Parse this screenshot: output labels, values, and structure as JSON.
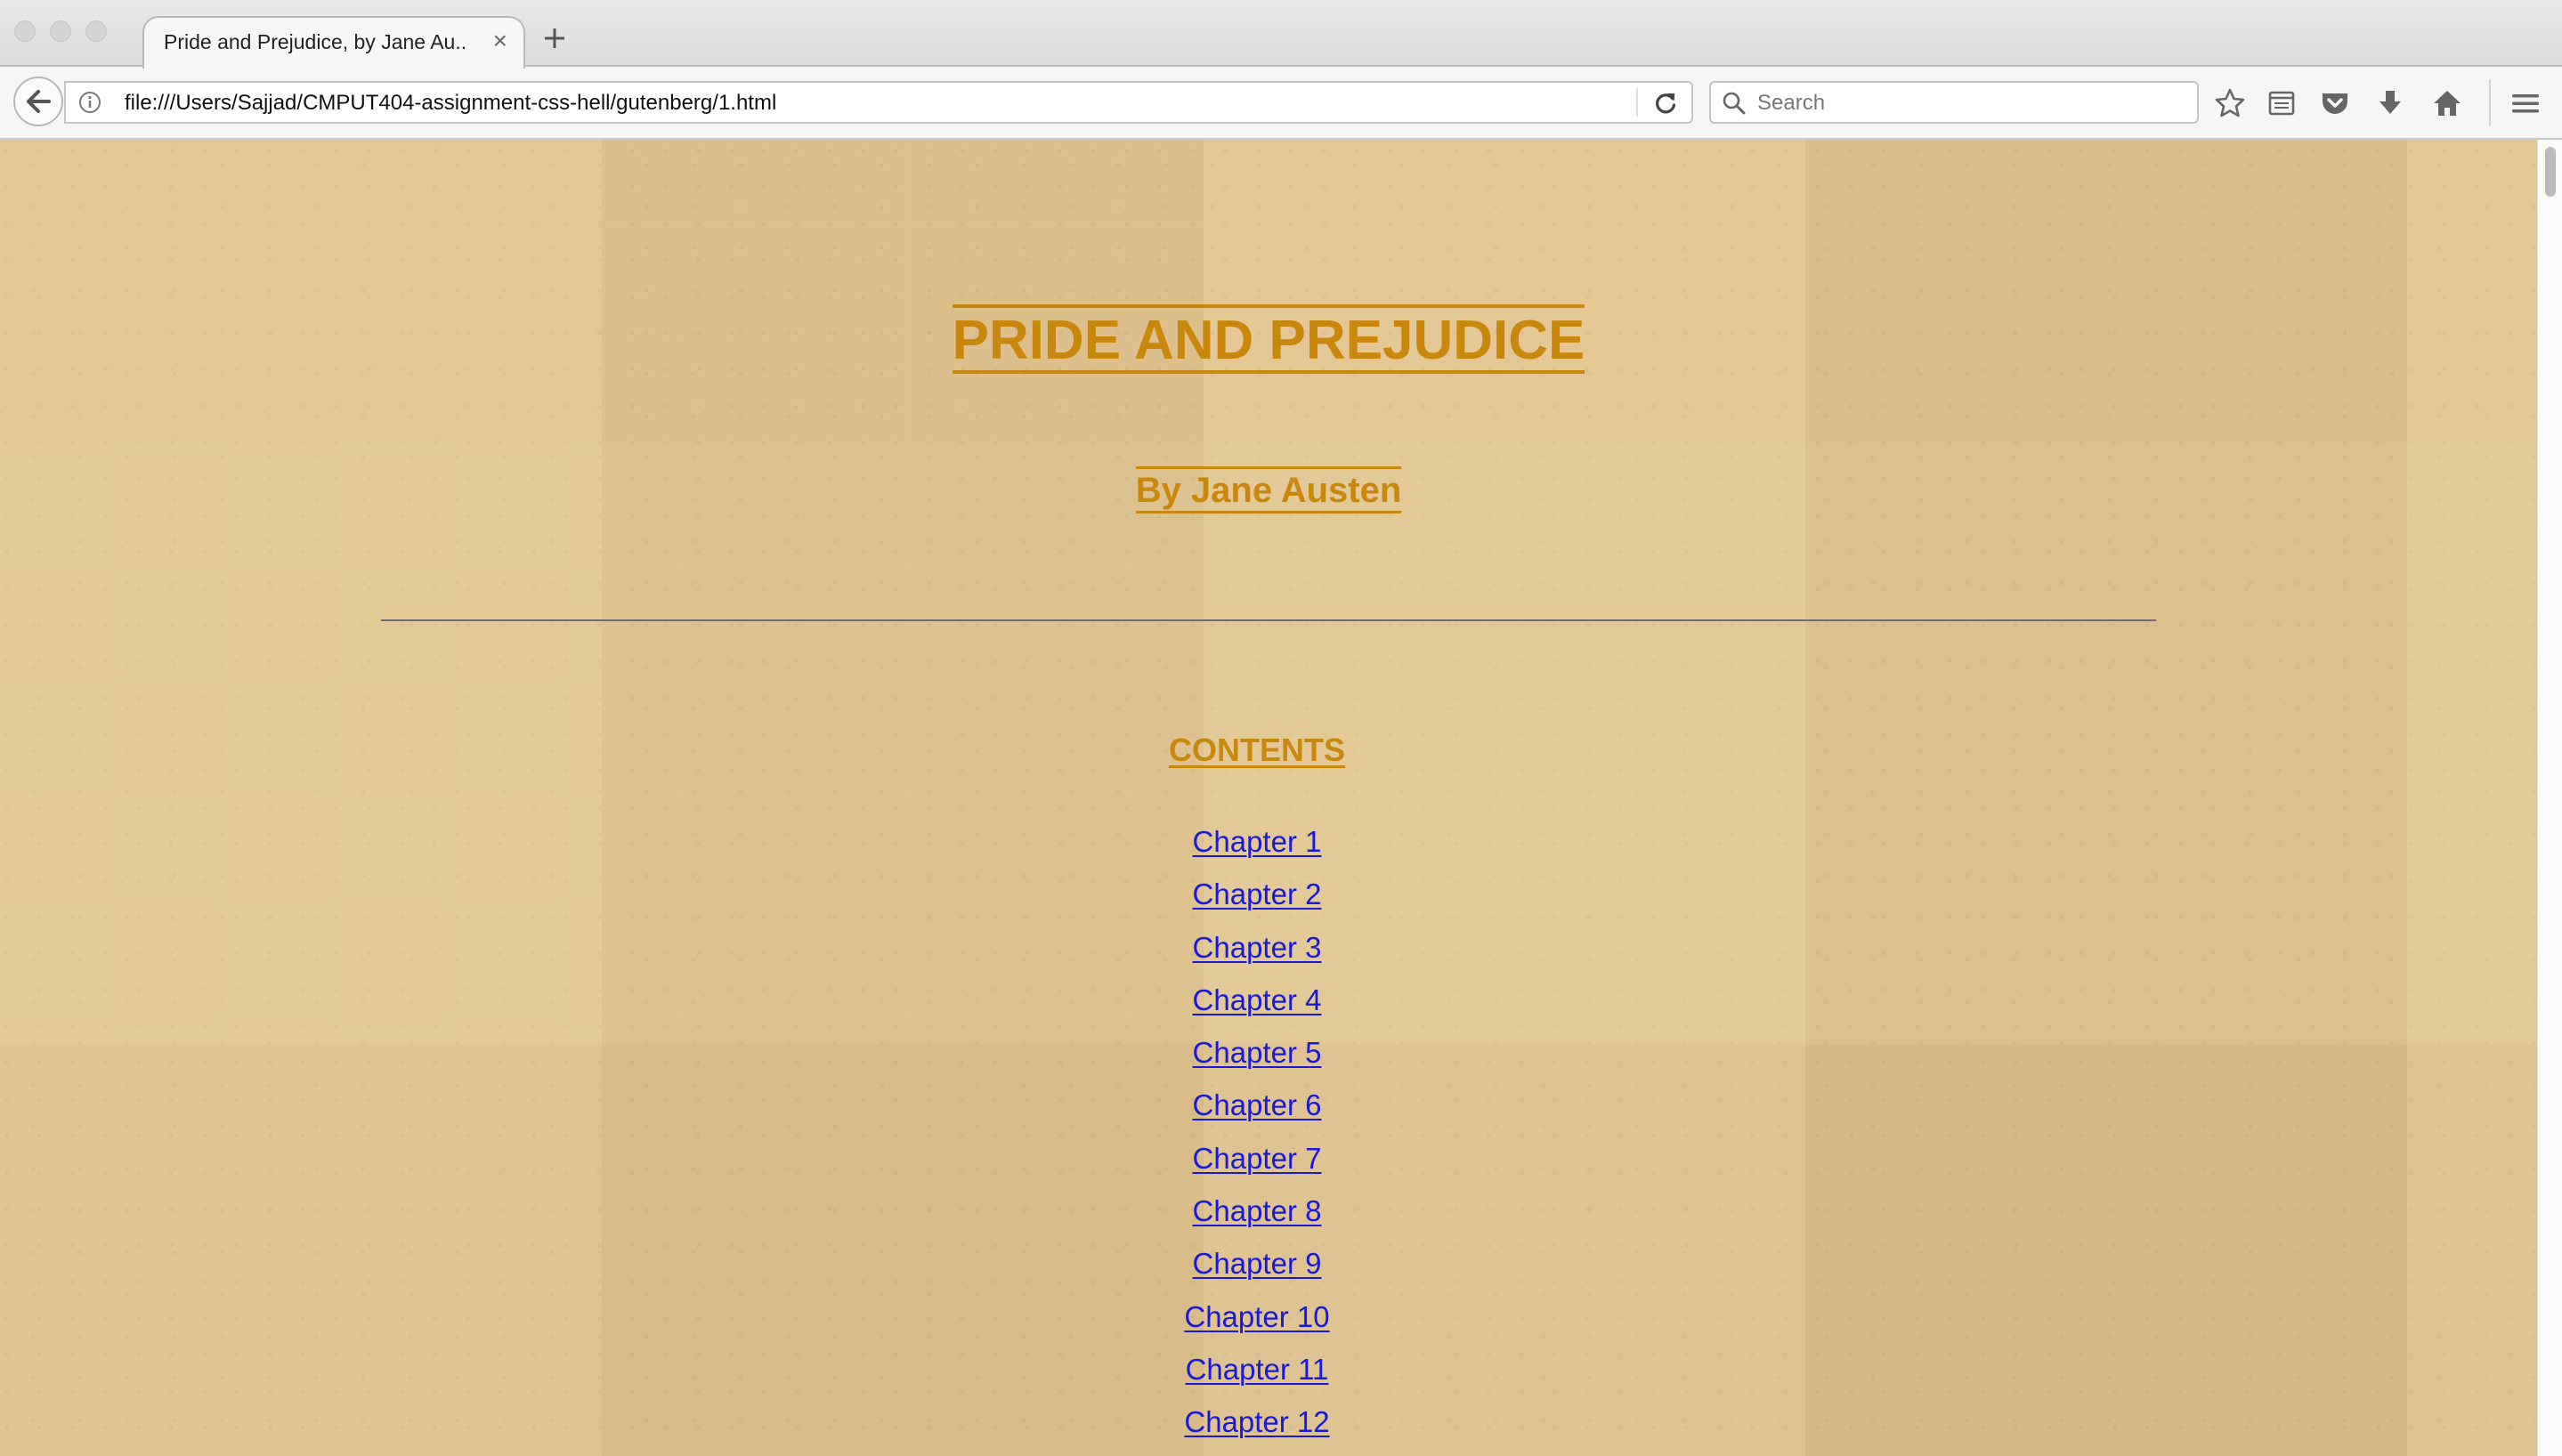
{
  "window": {
    "controls": [
      "close",
      "minimize",
      "zoom"
    ]
  },
  "tabs": [
    {
      "title": "Pride and Prejudice, by Jane Au...",
      "active": true,
      "close_icon": "×"
    }
  ],
  "new_tab_icon": "plus-icon",
  "navbar": {
    "back_icon": "back-arrow-icon",
    "info_icon": "info-icon",
    "url": "file:///Users/Sajjad/CMPUT404-assignment-css-hell/gutenberg/1.html",
    "reload_icon": "reload-icon",
    "search": {
      "placeholder": "Search",
      "value": "",
      "icon": "search-icon"
    },
    "toolbar_icons": [
      "bookmark-star-icon",
      "reader-view-icon",
      "pocket-icon",
      "downloads-icon",
      "home-icon",
      "hamburger-menu-icon"
    ]
  },
  "page": {
    "title": "PRIDE AND PREJUDICE",
    "author": "By Jane Austen",
    "contents_heading": "CONTENTS",
    "chapters": [
      "Chapter 1",
      "Chapter 2",
      "Chapter 3",
      "Chapter 4",
      "Chapter 5",
      "Chapter 6",
      "Chapter 7",
      "Chapter 8",
      "Chapter 9",
      "Chapter 10",
      "Chapter 11",
      "Chapter 12"
    ]
  },
  "colors": {
    "heading": "#c8880d",
    "link": "#1a1ad6",
    "background": "#e2c48f",
    "divider": "#6e6a78"
  }
}
